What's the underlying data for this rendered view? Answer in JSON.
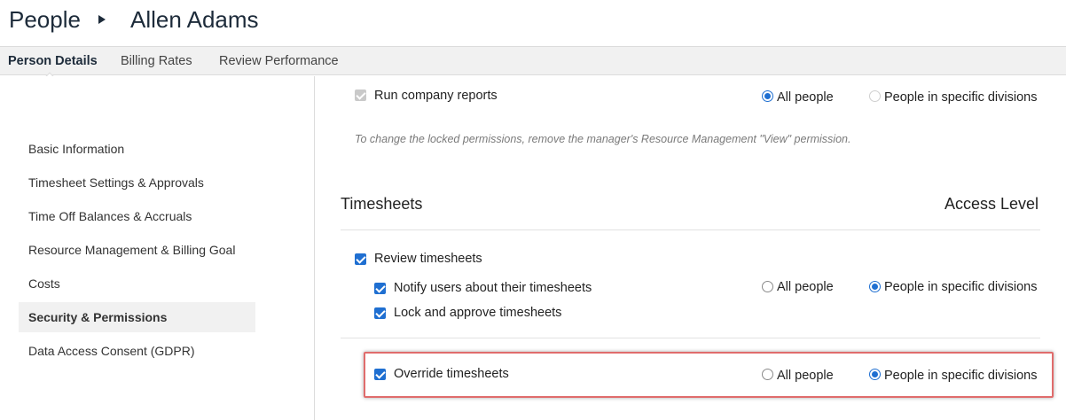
{
  "header": {
    "breadcrumb_root": "People",
    "breadcrumb_current": "Allen Adams"
  },
  "tabs": [
    {
      "label": "Person Details",
      "active": true
    },
    {
      "label": "Billing Rates",
      "active": false
    },
    {
      "label": "Review Performance",
      "active": false
    }
  ],
  "sidebar": {
    "items": [
      {
        "label": "Basic Information"
      },
      {
        "label": "Timesheet Settings & Approvals"
      },
      {
        "label": "Time Off Balances & Accruals"
      },
      {
        "label": "Resource Management & Billing Goal"
      },
      {
        "label": "Costs"
      },
      {
        "label": "Security & Permissions",
        "active": true
      },
      {
        "label": "Data Access Consent (GDPR)"
      }
    ]
  },
  "main": {
    "run_reports": {
      "label": "Run company reports",
      "checked": true,
      "disabled": true,
      "option_all": "All people",
      "option_specific": "People in specific divisions",
      "selected": "all"
    },
    "locked_note": "To change the locked permissions, remove the manager's Resource Management \"View\" permission.",
    "timesheets": {
      "title": "Timesheets",
      "access_header": "Access Level",
      "review": {
        "label": "Review timesheets",
        "checked": true
      },
      "notify": {
        "label": "Notify users about their timesheets",
        "checked": true
      },
      "lock": {
        "label": "Lock and approve timesheets",
        "checked": true
      },
      "group_option_all": "All people",
      "group_option_specific": "People in specific divisions",
      "group_selected": "specific",
      "override": {
        "label": "Override timesheets",
        "checked": true,
        "option_all": "All people",
        "option_specific": "People in specific divisions",
        "selected": "specific"
      }
    }
  },
  "colors": {
    "accent": "#1f6fd1",
    "highlight_border": "#e06c6c",
    "tab_bar": "#f1f1f1"
  }
}
